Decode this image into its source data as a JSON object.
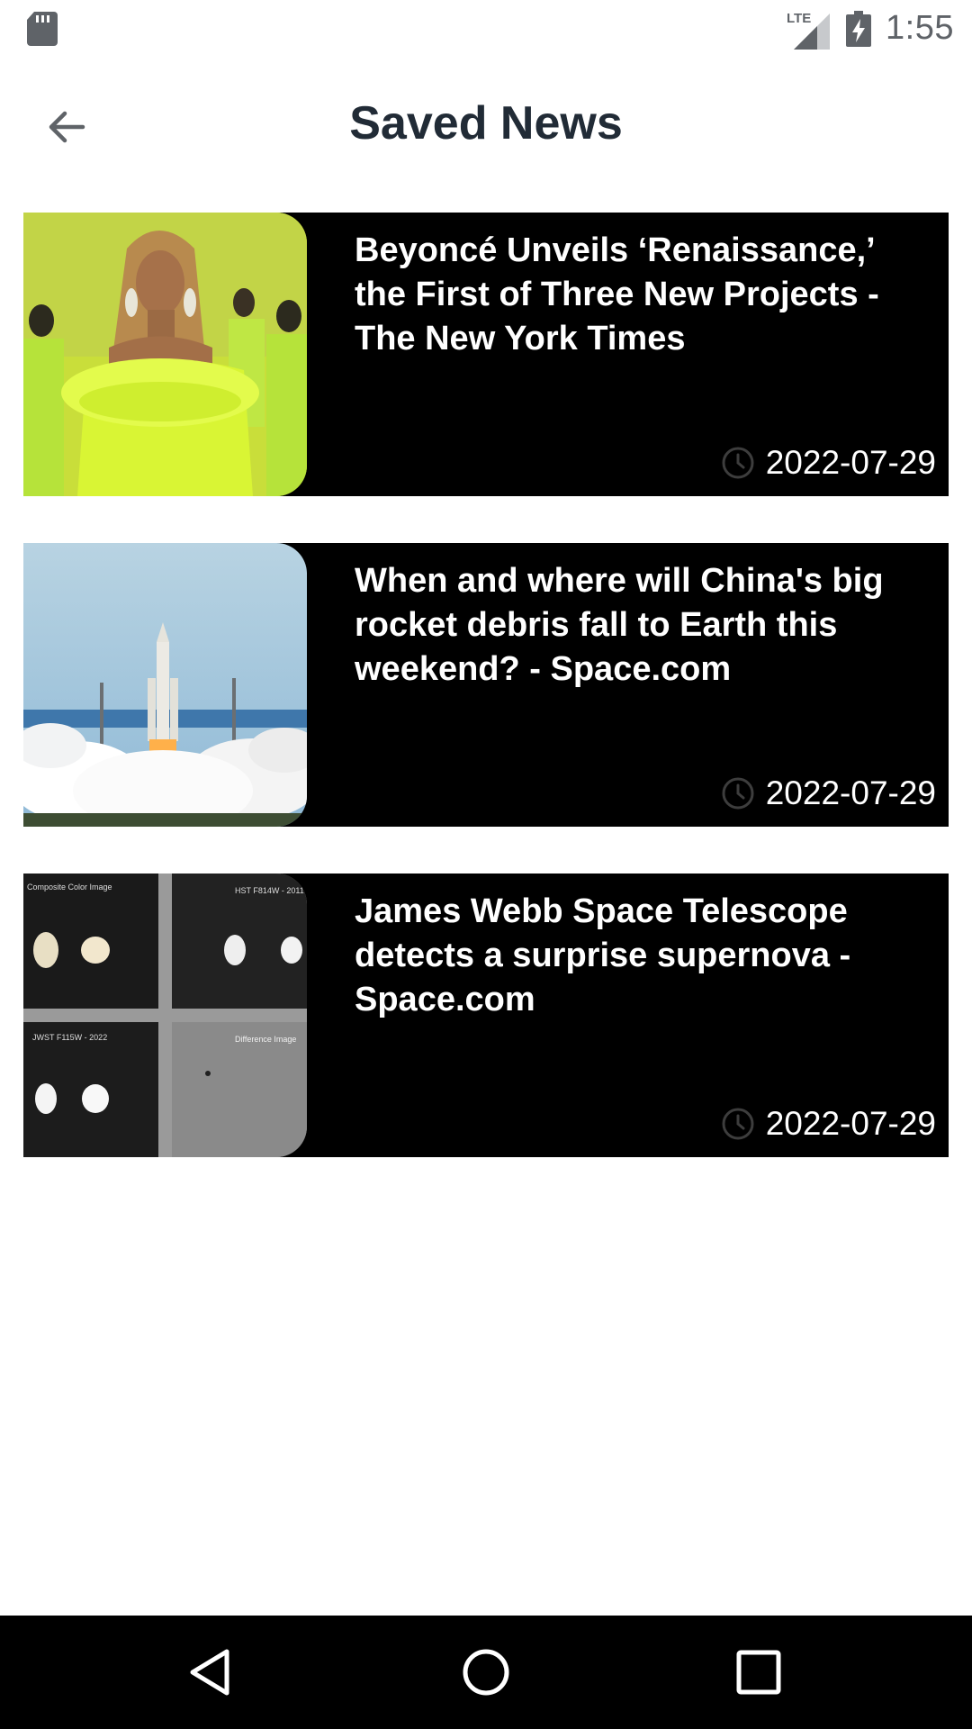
{
  "status_bar": {
    "time": "1:55",
    "network": "LTE",
    "icons": [
      "sd-card-icon",
      "lte-signal-icon",
      "battery-charging-icon"
    ]
  },
  "header": {
    "title": "Saved News",
    "back_icon": "arrow-back-icon"
  },
  "news": [
    {
      "title": "Beyoncé Unveils ‘Renaissance,’ the First of Three New Projects - The New York Times",
      "date": "2022-07-29",
      "thumbnail": "beyonce-yellow-feather-dress-photo"
    },
    {
      "title": "When and where will China's big rocket debris fall to Earth this weekend? - Space.com",
      "date": "2022-07-29",
      "thumbnail": "rocket-launch-photo"
    },
    {
      "title": "James Webb Space Telescope detects a surprise supernova - Space.com",
      "date": "2022-07-29",
      "thumbnail": "supernova-comparison-grid",
      "thumbnail_labels": [
        "Composite Color Image",
        "HST F814W - 2011",
        "JWST F115W - 2022",
        "Difference Image"
      ]
    }
  ],
  "nav_bar": {
    "icons": [
      "nav-back-icon",
      "nav-home-icon",
      "nav-recents-icon"
    ]
  },
  "colors": {
    "card_background": "#000000",
    "title_color": "#212b36",
    "status_icons": "#5f6368"
  }
}
